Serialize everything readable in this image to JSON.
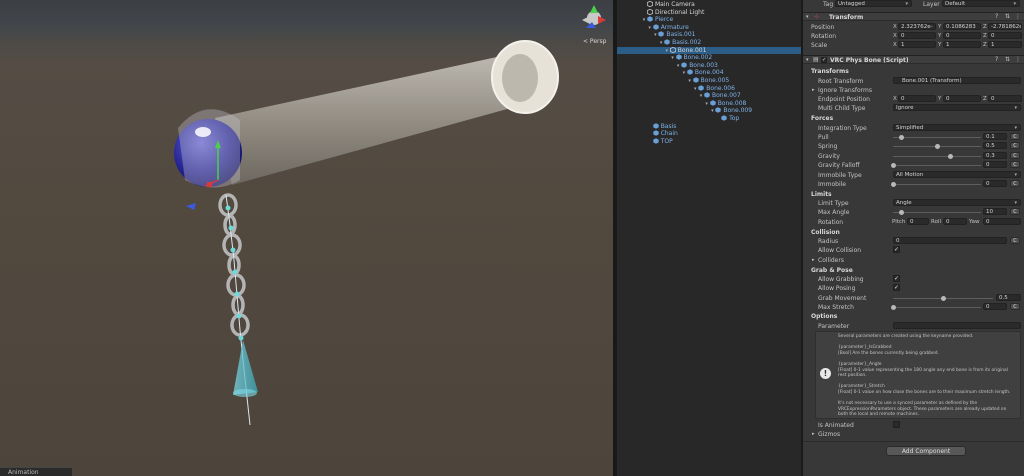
{
  "scene": {
    "persp_label": "< Persp",
    "bottom_tab": "Animation"
  },
  "hierarchy": {
    "items": [
      {
        "label": "Main Camera",
        "indent": 0,
        "color": "white",
        "arrow": "",
        "selected": false
      },
      {
        "label": "Directional Light",
        "indent": 0,
        "color": "white",
        "arrow": "",
        "selected": false
      },
      {
        "label": "Pierce",
        "indent": 0,
        "color": "blue",
        "arrow": "▾",
        "selected": false
      },
      {
        "label": "Armature",
        "indent": 1,
        "color": "blue",
        "arrow": "▾",
        "selected": false
      },
      {
        "label": "Basis.001",
        "indent": 2,
        "color": "blue",
        "arrow": "▾",
        "selected": false
      },
      {
        "label": "Basis.002",
        "indent": 3,
        "color": "blue",
        "arrow": "▾",
        "selected": false
      },
      {
        "label": "Bone.001",
        "indent": 4,
        "color": "white",
        "arrow": "▾",
        "selected": true
      },
      {
        "label": "Bone.002",
        "indent": 5,
        "color": "blue",
        "arrow": "▾",
        "selected": false
      },
      {
        "label": "Bone.003",
        "indent": 6,
        "color": "blue",
        "arrow": "▾",
        "selected": false
      },
      {
        "label": "Bone.004",
        "indent": 7,
        "color": "blue",
        "arrow": "▾",
        "selected": false
      },
      {
        "label": "Bone.005",
        "indent": 8,
        "color": "blue",
        "arrow": "▾",
        "selected": false
      },
      {
        "label": "Bone.006",
        "indent": 9,
        "color": "blue",
        "arrow": "▾",
        "selected": false
      },
      {
        "label": "Bone.007",
        "indent": 10,
        "color": "blue",
        "arrow": "▾",
        "selected": false
      },
      {
        "label": "Bone.008",
        "indent": 11,
        "color": "blue",
        "arrow": "▾",
        "selected": false
      },
      {
        "label": "Bone.009",
        "indent": 12,
        "color": "blue",
        "arrow": "▾",
        "selected": false
      },
      {
        "label": "Top",
        "indent": 13,
        "color": "blue",
        "arrow": "",
        "selected": false
      },
      {
        "label": "Basis",
        "indent": 1,
        "color": "blue",
        "arrow": "",
        "selected": false
      },
      {
        "label": "Chain",
        "indent": 1,
        "color": "blue",
        "arrow": "",
        "selected": false
      },
      {
        "label": "TOP",
        "indent": 1,
        "color": "blue",
        "arrow": "",
        "selected": false
      }
    ]
  },
  "inspector": {
    "tag_label": "Tag",
    "tag_value": "Untagged",
    "layer_label": "Layer",
    "layer_value": "Default",
    "transform": {
      "title": "Transform",
      "position_label": "Position",
      "rotation_label": "Rotation",
      "scale_label": "Scale",
      "position": {
        "x": "2.323762e-",
        "y": "0.1086283",
        "z": "-2.781862e-"
      },
      "rotation": {
        "x": "0",
        "y": "0",
        "z": "0"
      },
      "scale": {
        "x": "1",
        "y": "1",
        "z": "1"
      }
    },
    "physbone": {
      "title": "VRC Phys Bone (Script)",
      "sec_transforms": "Transforms",
      "root_transform_label": "Root Transform",
      "root_transform_value": "Bone.001 (Transform)",
      "ignore_transforms_label": "Ignore Transforms",
      "endpoint_label": "Endpoint Position",
      "endpoint": {
        "x": "0",
        "y": "0",
        "z": "0"
      },
      "multi_child_label": "Multi Child Type",
      "multi_child_value": "Ignore",
      "sec_forces": "Forces",
      "integration_label": "Integration Type",
      "integration_value": "Simplified",
      "pull_label": "Pull",
      "pull_value": "0.1",
      "pull_level": 0.1,
      "spring_label": "Spring",
      "spring_value": "0.5",
      "spring_level": 0.5,
      "gravity_label": "Gravity",
      "gravity_value": "0.3",
      "gravity_level": 0.65,
      "gravity_falloff_label": "Gravity Falloff",
      "gravity_falloff_value": "0",
      "gravity_falloff_level": 0,
      "immobile_type_label": "Immobile Type",
      "immobile_type_value": "All Motion",
      "immobile_label": "Immobile",
      "immobile_value": "0",
      "immobile_level": 0,
      "sec_limits": "Limits",
      "limit_type_label": "Limit Type",
      "limit_type_value": "Angle",
      "max_angle_label": "Max Angle",
      "max_angle_value": "10",
      "max_angle_level": 0.056,
      "rotation_label": "Rotation",
      "pitch_label": "Pitch",
      "pitch_value": "0",
      "roll_label": "Roll",
      "roll_value": "0",
      "yaw_label": "Yaw",
      "yaw_value": "0",
      "sec_collision": "Collision",
      "radius_label": "Radius",
      "radius_value": "0",
      "allow_collision_label": "Allow Collision",
      "colliders_label": "Colliders",
      "sec_grab": "Grab & Pose",
      "allow_grabbing_label": "Allow Grabbing",
      "allow_posing_label": "Allow Posing",
      "grab_movement_label": "Grab Movement",
      "grab_movement_value": "0.5",
      "grab_movement_level": 0.5,
      "max_stretch_label": "Max Stretch",
      "max_stretch_value": "0",
      "max_stretch_level": 0,
      "sec_options": "Options",
      "parameter_label": "Parameter",
      "parameter_value": "",
      "help_lines": [
        "Several parameters are created using the keyname provided.",
        "",
        "{parameter}_IsGrabbed",
        " [Bool] Are the bones currently being grabbed.",
        "",
        "{parameter}_Angle",
        " [Float] 0-1 value representing the 180 angle any end bone is from its original",
        "rest position.",
        "",
        "{parameter}_Stretch",
        " [Float] 0-1 value on how close the bones are to their maximum stretch length.",
        "",
        "It's not necessary to use a synced parameter as defined by the",
        "VRCExpressionParameters object.  These parameters are already updated on",
        "both the local and remote machines."
      ],
      "is_animated_label": "Is Animated",
      "gizmos_label": "Gizmos"
    },
    "add_component": "Add Component",
    "c_label": "C"
  }
}
